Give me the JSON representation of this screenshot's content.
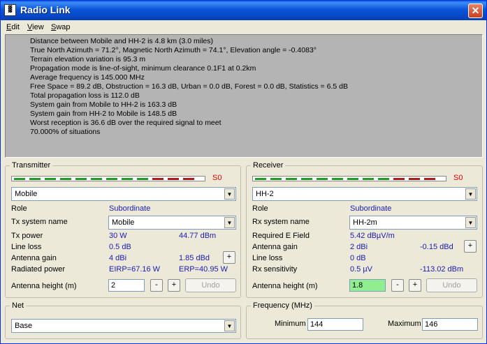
{
  "window": {
    "title": "Radio Link",
    "icon_text": "▓",
    "close_label": "✕"
  },
  "menu": [
    {
      "label": "Edit",
      "underline": "E",
      "rest": "dit"
    },
    {
      "label": "View",
      "underline": "V",
      "rest": "iew"
    },
    {
      "label": "Swap",
      "underline": "S",
      "rest": "wap"
    }
  ],
  "report": [
    "Distance between Mobile and HH-2 is 4.8 km (3.0 miles)",
    "True North Azimuth = 71.2°, Magnetic North Azimuth = 74.1°, Elevation angle = -0.4083°",
    "Terrain elevation variation is 95.3 m",
    "Propagation mode is line-of-sight, minimum clearance 0.1F1 at 0.2km",
    "Average frequency is 145.000 MHz",
    "Free Space = 89.2 dB, Obstruction = 16.3 dB, Urban = 0.0 dB, Forest = 0.0 dB, Statistics = 6.5 dB",
    "Total propagation loss is 112.0 dB",
    "System gain from Mobile to HH-2 is 163.3 dB",
    "System gain from HH-2 to Mobile is 148.5 dB",
    "Worst reception is 36.6 dB over the required signal to meet",
    "70.000% of situations"
  ],
  "transmitter": {
    "group_title": "Transmitter",
    "meter_label": "S0",
    "station": "Mobile",
    "role_label": "Role",
    "role_value": "Subordinate",
    "system_label": "Tx system name",
    "system_value": "Mobile",
    "power_label": "Tx power",
    "power_w": "30 W",
    "power_dbm": "44.77 dBm",
    "loss_label": "Line loss",
    "loss_value": "0.5 dB",
    "gain_label": "Antenna gain",
    "gain_dbi": "4 dBi",
    "gain_dbd": "1.85 dBd",
    "radiated_label": "Radiated power",
    "eirp": "EIRP=67.16 W",
    "erp": "ERP=40.95 W",
    "height_label": "Antenna height (m)",
    "height_value": "2",
    "minus": "-",
    "plus": "+",
    "undo": "Undo"
  },
  "receiver": {
    "group_title": "Receiver",
    "meter_label": "S0",
    "station": "HH-2",
    "role_label": "Role",
    "role_value": "Subordinate",
    "system_label": "Rx system name",
    "system_value": "HH-2m",
    "field_label": "Required E Field",
    "field_value": "5.42 dBµV/m",
    "gain_label": "Antenna gain",
    "gain_dbi": "2 dBi",
    "gain_dbd": "-0.15 dBd",
    "loss_label": "Line loss",
    "loss_value": "0 dB",
    "sens_label": "Rx sensitivity",
    "sens_uv": "0.5 µV",
    "sens_dbm": "-113.02 dBm",
    "height_label": "Antenna height (m)",
    "height_value": "1.8",
    "minus": "-",
    "plus": "+",
    "undo": "Undo"
  },
  "net": {
    "group_title": "Net",
    "value": "Base"
  },
  "frequency": {
    "group_title": "Frequency (MHz)",
    "min_label": "Minimum",
    "min_value": "144",
    "max_label": "Maximum",
    "max_value": "146"
  },
  "colors": {
    "meter_green": "#1E9E1E",
    "meter_red": "#B01818",
    "highlight_field": "#90EE90"
  },
  "icons": {
    "dropdown": "▼"
  }
}
